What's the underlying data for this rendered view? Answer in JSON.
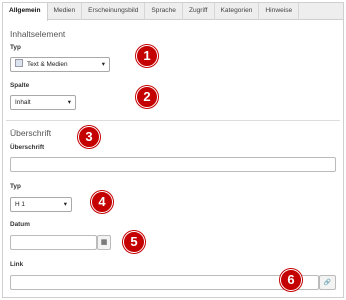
{
  "tabs": [
    {
      "label": "Allgemein",
      "active": true
    },
    {
      "label": "Medien"
    },
    {
      "label": "Erscheinungsbild"
    },
    {
      "label": "Sprache"
    },
    {
      "label": "Zugriff"
    },
    {
      "label": "Kategorien"
    },
    {
      "label": "Hinweise"
    }
  ],
  "content_element": {
    "title": "Inhaltselement",
    "type_label": "Typ",
    "type_value": "Text & Medien",
    "column_label": "Spalte",
    "column_value": "Inhalt"
  },
  "header": {
    "title": "Überschrift",
    "heading_label": "Überschrift",
    "heading_value": "",
    "type_label": "Typ",
    "type_value": "H 1",
    "date_label": "Datum",
    "date_value": "",
    "link_label": "Link",
    "link_value": ""
  },
  "badges": [
    "1",
    "2",
    "3",
    "4",
    "5",
    "6"
  ],
  "icons": {
    "select_arrow": "▾",
    "calendar": "▦",
    "link": "🔗"
  },
  "colors": {
    "badge": "#c40000"
  }
}
